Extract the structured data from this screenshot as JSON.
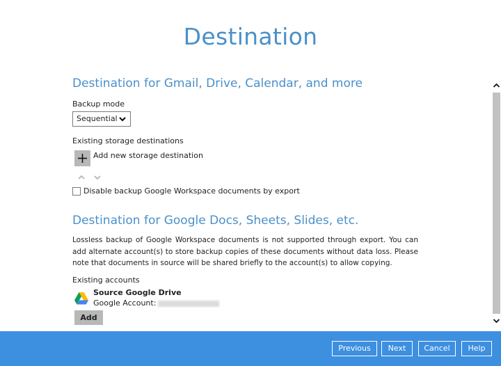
{
  "page": {
    "title": "Destination"
  },
  "section1": {
    "heading": "Destination for Gmail, Drive, Calendar, and more",
    "backup_mode_label": "Backup mode",
    "backup_mode_value": "Sequential",
    "existing_storage_label": "Existing storage destinations",
    "add_storage_label": "Add new storage destination",
    "disable_export_label": "Disable backup Google Workspace documents by export",
    "disable_export_checked": false
  },
  "section2": {
    "heading": "Destination for Google Docs, Sheets, Slides, etc.",
    "note": "Lossless backup of Google Workspace documents is not supported through export. You can add alternate account(s) to store backup copies of these documents without data loss. Please note that documents in source will be shared briefly to the account(s) to allow copying.",
    "existing_accounts_label": "Existing accounts",
    "accounts": [
      {
        "name": "Source Google Drive",
        "account_label": "Google Account:",
        "icon": "google-drive-icon"
      }
    ],
    "add_button": "Add"
  },
  "footer": {
    "previous": "Previous",
    "next": "Next",
    "cancel": "Cancel",
    "help": "Help"
  },
  "colors": {
    "accent": "#4a90c9",
    "footer_bg": "#3d8fe0",
    "button_gray": "#b8b8b8"
  }
}
